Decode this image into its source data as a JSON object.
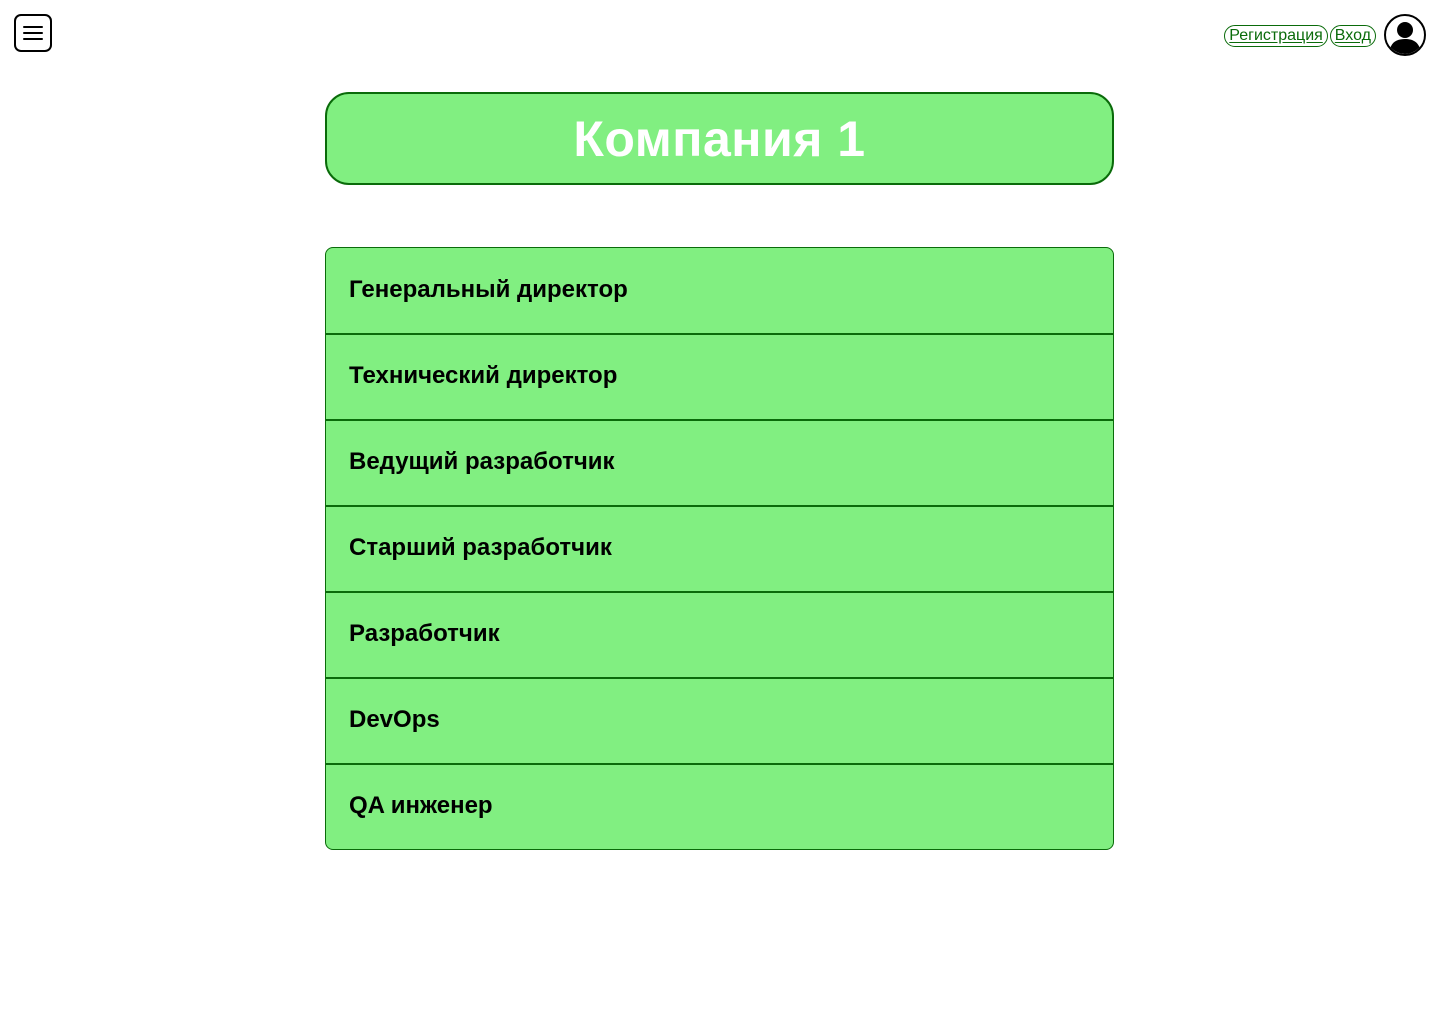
{
  "header": {
    "register_label": "Регистрация",
    "login_label": "Вход"
  },
  "company": {
    "title": "Компания 1"
  },
  "roles": [
    {
      "label": "Генеральный директор"
    },
    {
      "label": "Технический директор"
    },
    {
      "label": "Ведущий разработчик"
    },
    {
      "label": "Старший разработчик"
    },
    {
      "label": "Разработчик"
    },
    {
      "label": "DevOps"
    },
    {
      "label": "QA инженер"
    }
  ],
  "colors": {
    "accent_fill": "#81ef81",
    "accent_border": "#0a6b0a",
    "title_text": "#ffffff"
  },
  "icons": {
    "menu": "hamburger-menu-icon",
    "profile": "user-avatar-icon"
  }
}
